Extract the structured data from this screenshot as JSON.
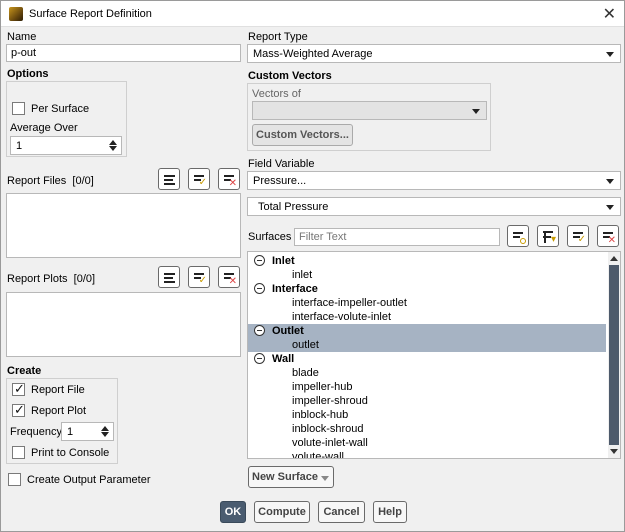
{
  "window": {
    "title": "Surface Report Definition",
    "close_icon": "close-icon"
  },
  "left": {
    "name_label": "Name",
    "name_value": "p-out",
    "options_label": "Options",
    "per_surface_label": "Per Surface",
    "per_surface_checked": false,
    "average_over_label": "Average Over",
    "average_over_value": "1",
    "report_files_label": "Report Files",
    "report_files_count": "[0/0]",
    "report_plots_label": "Report Plots",
    "report_plots_count": "[0/0]",
    "create_label": "Create",
    "report_file_label": "Report File",
    "report_file_checked": true,
    "report_plot_label": "Report Plot",
    "report_plot_checked": true,
    "frequency_label": "Frequency",
    "frequency_value": "1",
    "print_to_console_label": "Print to Console",
    "print_to_console_checked": false,
    "create_output_param_label": "Create Output Parameter",
    "create_output_param_checked": false
  },
  "right": {
    "report_type_label": "Report Type",
    "report_type_value": "Mass-Weighted Average",
    "custom_vectors_label": "Custom Vectors",
    "vectors_of_label": "Vectors of",
    "vectors_of_value": "",
    "custom_vectors_button": "Custom Vectors...",
    "field_variable_label": "Field Variable",
    "field_variable_value": "Pressure...",
    "field_variable_sub_value": "Total Pressure",
    "surfaces_label": "Surfaces",
    "surfaces_filter_placeholder": "Filter Text",
    "new_surface_button": "New Surface"
  },
  "surfaces_tree": [
    {
      "group": "Inlet",
      "items": [
        "inlet"
      ]
    },
    {
      "group": "Interface",
      "items": [
        "interface-impeller-outlet",
        "interface-volute-inlet"
      ]
    },
    {
      "group": "Outlet",
      "items": [
        "outlet"
      ],
      "selected": true
    },
    {
      "group": "Wall",
      "items": [
        "blade",
        "impeller-hub",
        "impeller-shroud",
        "inblock-hub",
        "inblock-shroud",
        "volute-inlet-wall",
        "volute-wall"
      ]
    }
  ],
  "buttons": {
    "ok": "OK",
    "compute": "Compute",
    "cancel": "Cancel",
    "help": "Help"
  },
  "colors": {
    "selection": "#a6b3c3",
    "primary_button": "#4a5c70",
    "scroll_thumb": "#4d5a6b"
  }
}
